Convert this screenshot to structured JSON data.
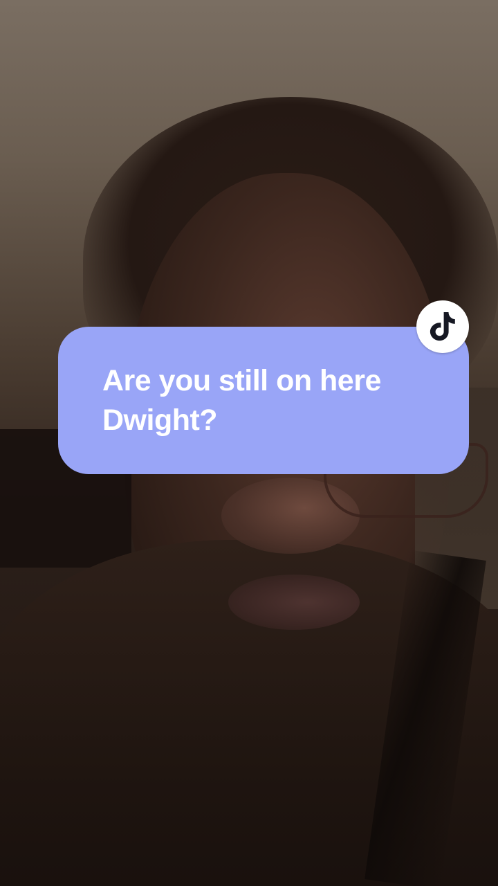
{
  "comment_sticker": {
    "text": "Are you still on here\nDwight?",
    "bubble_color": "#99a5f7",
    "text_color": "#ffffff"
  },
  "brand_badge": {
    "icon": "tiktok-logo-icon",
    "badge_color": "#ffffff",
    "icon_color": "#161823"
  }
}
